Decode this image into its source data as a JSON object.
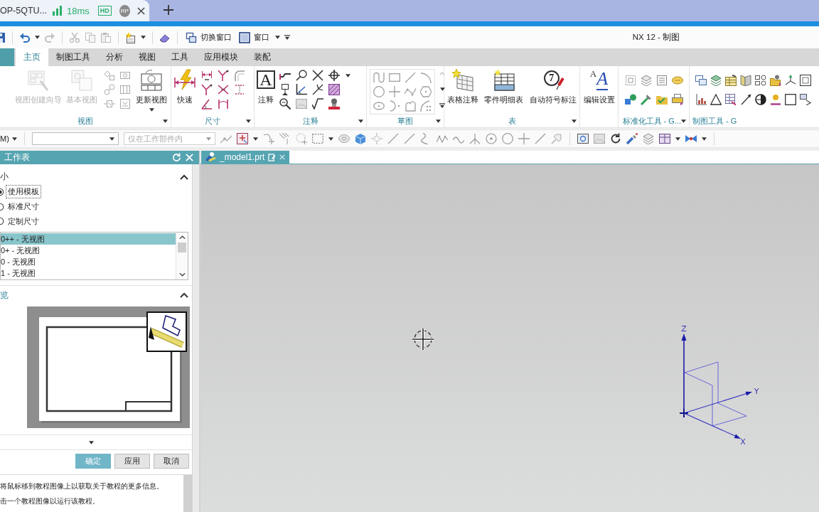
{
  "browser_tab": {
    "title": "OP-5QTU...",
    "latency": "18ms",
    "badge": "HD",
    "avatar": "RP"
  },
  "quick_access": {
    "buttons": [
      {
        "label": "切换窗口"
      },
      {
        "label": "窗口"
      }
    ],
    "window_title": "NX 12 - 制图"
  },
  "ribbon_tabs": [
    {
      "label": "主页",
      "selected": true
    },
    {
      "label": "制图工具",
      "selected": false
    },
    {
      "label": "分析",
      "selected": false
    },
    {
      "label": "视图",
      "selected": false
    },
    {
      "label": "工具",
      "selected": false
    },
    {
      "label": "应用模块",
      "selected": false
    },
    {
      "label": "装配",
      "selected": false
    }
  ],
  "ribbon_groups": [
    {
      "kind": "view",
      "label": "视图",
      "buttons": [
        {
          "label": "视图创建向导",
          "disabled": true
        },
        {
          "label": "基本视图",
          "disabled": true
        },
        {
          "label": "更新视图",
          "disabled": false
        }
      ]
    },
    {
      "kind": "dimension",
      "label": "尺寸",
      "buttons": [
        {
          "label": "快速",
          "disabled": false
        }
      ]
    },
    {
      "kind": "annotation",
      "label": "注释",
      "buttons": [
        {
          "label": "注释",
          "glyph": "A",
          "disabled": false
        }
      ]
    },
    {
      "kind": "sketch",
      "label": "草图"
    },
    {
      "kind": "table",
      "label": "表",
      "buttons": [
        {
          "label": "表格注释",
          "disabled": false
        },
        {
          "label": "零件明细表",
          "disabled": false
        },
        {
          "label": "自动符号标注",
          "glyph": "7",
          "disabled": false
        }
      ]
    },
    {
      "kind": "style",
      "buttons": [
        {
          "label": "编辑设置",
          "glyphs": [
            "A",
            "A"
          ],
          "disabled": false
        }
      ]
    },
    {
      "kind": "standard",
      "label": "标准化工具 - G..."
    },
    {
      "kind": "drafting",
      "label": "制图工具 - G"
    }
  ],
  "selection_bar": {
    "menu": "M)",
    "scope": {
      "value": "仅在工作部件内",
      "disabled": true
    }
  },
  "sheet_panel": {
    "title": "工作表",
    "sections": [
      {
        "title": "小",
        "expanded": true
      },
      {
        "title": "览",
        "expanded": true
      }
    ],
    "size_options": [
      {
        "label": "使用模板",
        "selected": true
      },
      {
        "label": "标准尺寸",
        "selected": false
      },
      {
        "label": "定制尺寸",
        "selected": false
      }
    ],
    "sheet_list": [
      {
        "label": "0++ - 无视图",
        "selected": true
      },
      {
        "label": "0+ - 无视图",
        "selected": false
      },
      {
        "label": "0 - 无视图",
        "selected": false
      },
      {
        "label": "1 - 无视图",
        "selected": false
      }
    ],
    "buttons": [
      {
        "label": "确定",
        "kind": "primary"
      },
      {
        "label": "应用",
        "kind": "normal"
      },
      {
        "label": "取消",
        "kind": "normal"
      }
    ],
    "help": [
      "将鼠标移到教程图像上以获取关于教程的更多信息。",
      "击一个教程图像以运行该教程。"
    ]
  },
  "document_tab": {
    "title": "_model1.prt"
  },
  "canvas": {
    "axes": [
      {
        "label": "Z"
      },
      {
        "label": "Y"
      },
      {
        "label": "X"
      }
    ]
  }
}
